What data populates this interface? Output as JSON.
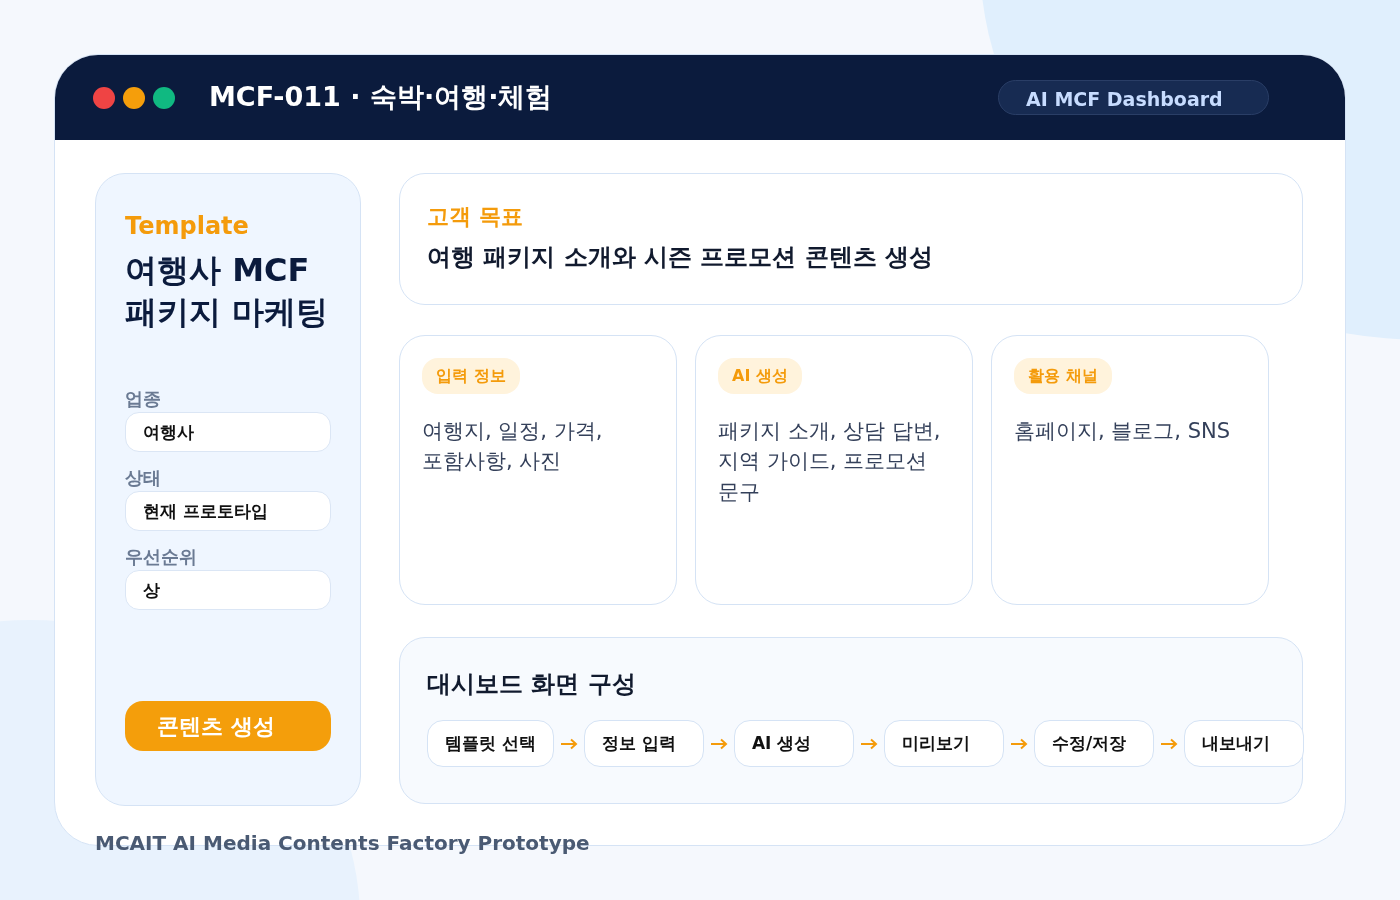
{
  "window": {
    "title": "MCF-011 · 숙박·여행·체험",
    "badge": "AI MCF Dashboard"
  },
  "sidebar": {
    "eyebrow": "Template",
    "title": "여행사 MCF\n패키지 마케팅",
    "fields": [
      {
        "label": "업종",
        "value": "여행사"
      },
      {
        "label": "상태",
        "value": "현재 프로토타입"
      },
      {
        "label": "우선순위",
        "value": "상"
      }
    ],
    "button": "콘텐츠 생성"
  },
  "goal": {
    "label": "고객 목표",
    "text": "여행 패키지 소개와 시즌 프로모션 콘텐츠 생성"
  },
  "cards": [
    {
      "tag": "입력 정보",
      "text": "여행지, 일정, 가격,\n포함사항, 사진"
    },
    {
      "tag": "AI 생성",
      "text": "패키지 소개, 상담 답변,\n지역 가이드, 프로모션\n문구"
    },
    {
      "tag": "활용 채널",
      "text": "홈페이지, 블로그, SNS"
    }
  ],
  "dashboard": {
    "title": "대시보드 화면 구성",
    "steps": [
      "템플릿 선택",
      "정보 입력",
      "AI 생성",
      "미리보기",
      "수정/저장",
      "내보내기"
    ]
  },
  "footer": "MCAIT AI Media Contents Factory Prototype"
}
